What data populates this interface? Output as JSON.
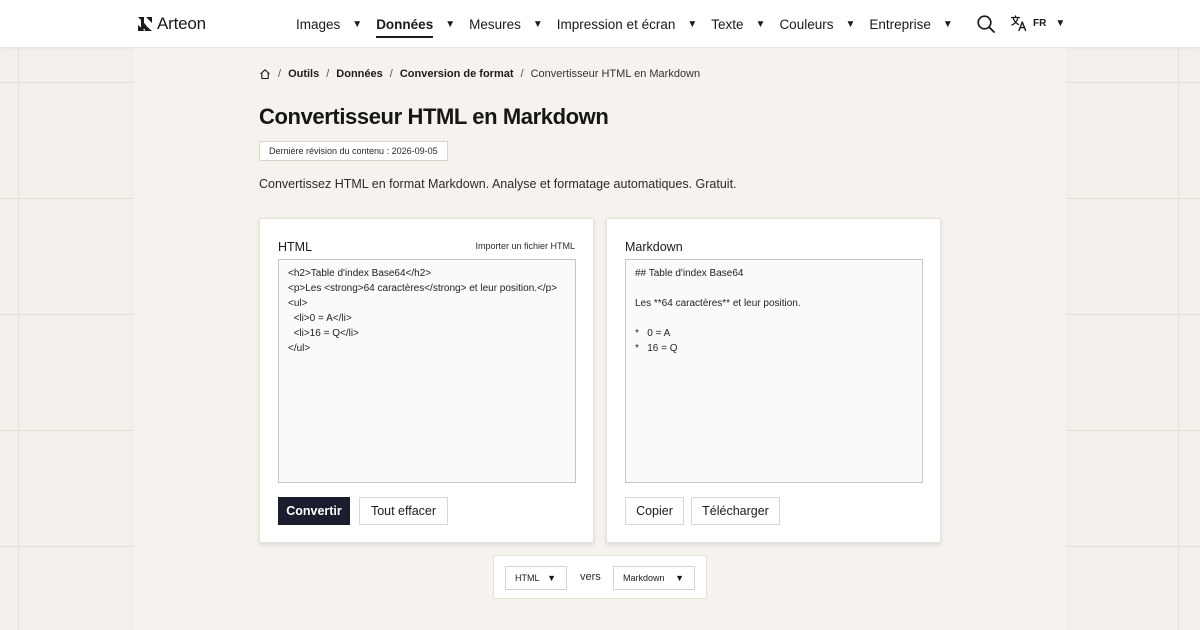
{
  "brand": {
    "name": "Arteon"
  },
  "nav": {
    "items": [
      {
        "label": "Images",
        "active": false
      },
      {
        "label": "Données",
        "active": true
      },
      {
        "label": "Mesures",
        "active": false
      },
      {
        "label": "Impression et écran",
        "active": false
      },
      {
        "label": "Texte",
        "active": false
      },
      {
        "label": "Couleurs",
        "active": false
      },
      {
        "label": "Entreprise",
        "active": false
      }
    ],
    "caret": "▼",
    "language": "FR"
  },
  "breadcrumb": {
    "items": [
      "Outils",
      "Données",
      "Conversion de format"
    ],
    "current": "Convertisseur HTML en Markdown",
    "separator": "/"
  },
  "page": {
    "title": "Convertisseur HTML en Markdown",
    "revision": "Dernière révision du contenu : 2026-09-05",
    "description": "Convertissez HTML en format Markdown. Analyse et formatage automatiques. Gratuit."
  },
  "input_panel": {
    "title": "HTML",
    "import_label": "Importer un fichier HTML",
    "value": "<h2>Table d'index Base64</h2>\n<p>Les <strong>64 caractères</strong> et leur position.</p>\n<ul>\n  <li>0 = A</li>\n  <li>16 = Q</li>\n</ul>",
    "convert_label": "Convertir",
    "clear_label": "Tout effacer"
  },
  "output_panel": {
    "title": "Markdown",
    "value": "## Table d'index Base64\n\nLes **64 caractères** et leur position.\n\n*   0 = A\n*   16 = Q",
    "copy_label": "Copier",
    "download_label": "Télécharger"
  },
  "conversion": {
    "from": "HTML",
    "connector": "vers",
    "to": "Markdown"
  },
  "colors": {
    "primary_button": "#1b1d2e",
    "background": "#f3f0ec",
    "panel": "#f6f3ef"
  }
}
